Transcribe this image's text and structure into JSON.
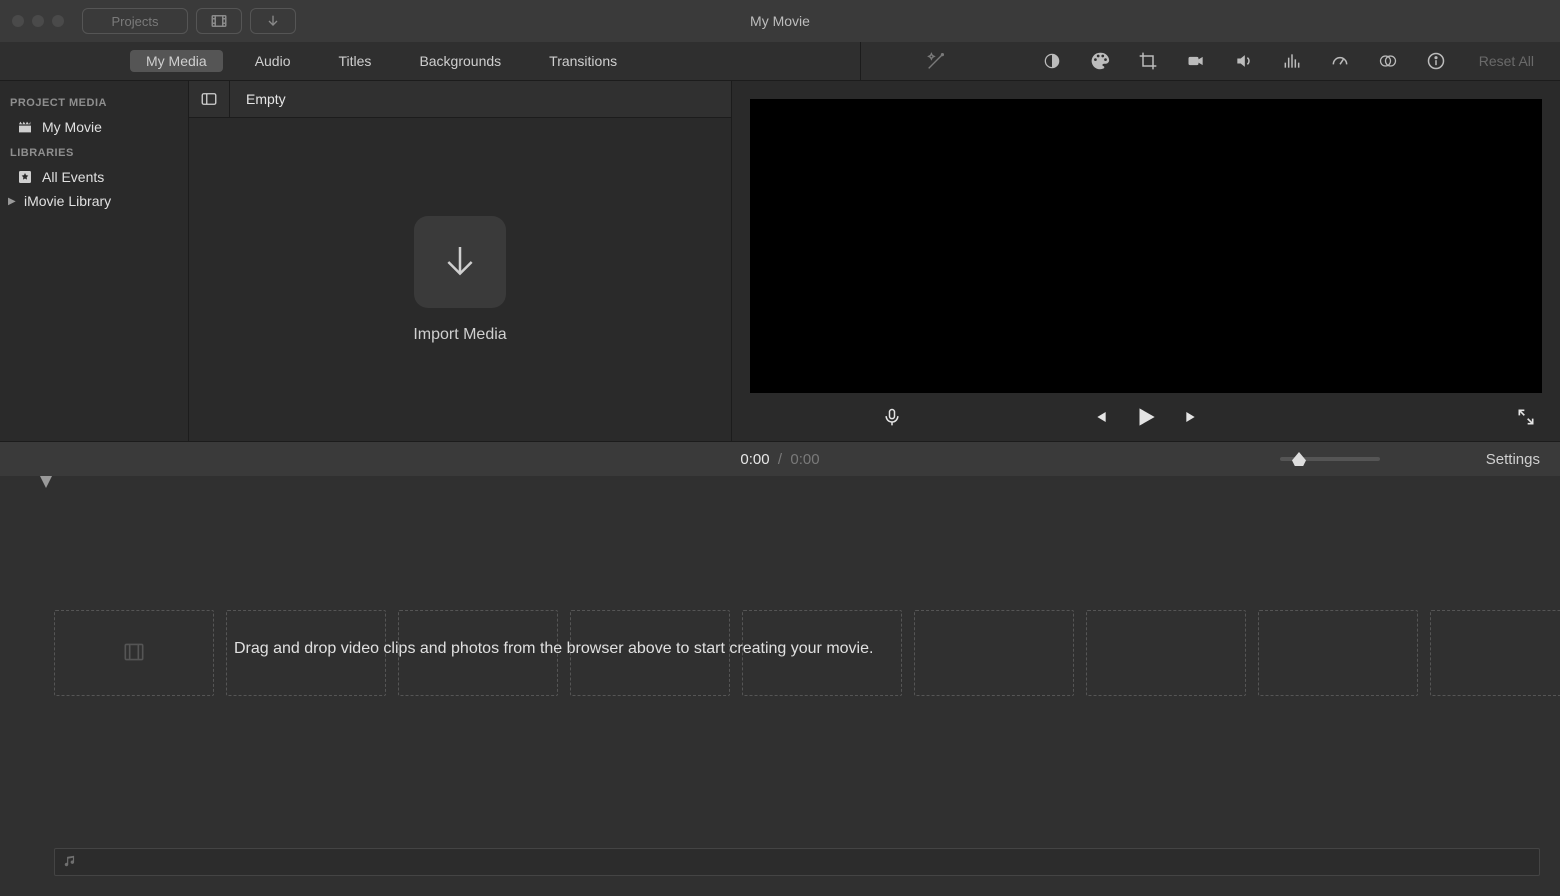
{
  "titlebar": {
    "projects": "Projects",
    "window_title": "My Movie"
  },
  "tabs": {
    "my_media": "My Media",
    "audio": "Audio",
    "titles": "Titles",
    "backgrounds": "Backgrounds",
    "transitions": "Transitions"
  },
  "inspector": {
    "reset_all": "Reset All"
  },
  "sidebar": {
    "project_media_header": "PROJECT MEDIA",
    "project_name": "My Movie",
    "libraries_header": "LIBRARIES",
    "all_events": "All Events",
    "imovie_library": "iMovie Library"
  },
  "browser": {
    "header": "Empty",
    "import_label": "Import Media"
  },
  "timecode": {
    "current": "0:00",
    "separator": "/",
    "duration": "0:00",
    "settings": "Settings"
  },
  "timeline": {
    "hint": "Drag and drop video clips and photos from the browser above to start creating your movie."
  }
}
